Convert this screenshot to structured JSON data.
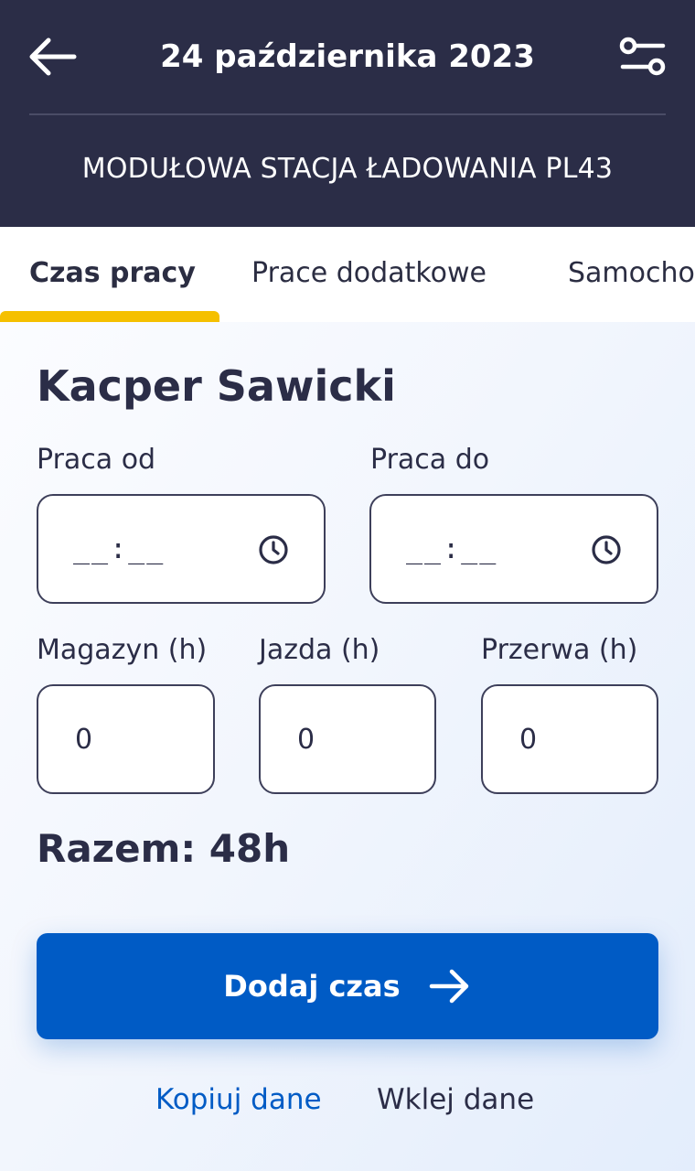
{
  "header": {
    "date_title": "24 października 2023",
    "subtitle": "MODUŁOWA STACJA ŁADOWANIA PL43",
    "back_icon": "arrow-left-icon",
    "filter_icon": "sliders-icon"
  },
  "tabs": [
    {
      "label": "Czas pracy",
      "active": true
    },
    {
      "label": "Prace dodatkowe",
      "active": false
    },
    {
      "label": "Samochody",
      "active": false
    }
  ],
  "form": {
    "person_name": "Kacper Sawicki",
    "work_from": {
      "label": "Praca od",
      "value": "__:__",
      "icon": "clock-icon"
    },
    "work_to": {
      "label": "Praca do",
      "value": "__:__",
      "icon": "clock-icon"
    },
    "warehouse": {
      "label": "Magazyn (h)",
      "value": "0"
    },
    "driving": {
      "label": "Jazda (h)",
      "value": "0"
    },
    "break": {
      "label": "Przerwa (h)",
      "value": "0"
    }
  },
  "total": "Razem: 48h",
  "actions": {
    "add_time": "Dodaj czas",
    "add_time_icon": "arrow-right-icon",
    "copy": "Kopiuj dane",
    "paste": "Wklej dane"
  },
  "colors": {
    "header_bg": "#2b2d47",
    "accent_yellow": "#f5c000",
    "primary_blue": "#005bc5",
    "link_blue": "#005bc5",
    "text_dark": "#2b2d47"
  }
}
